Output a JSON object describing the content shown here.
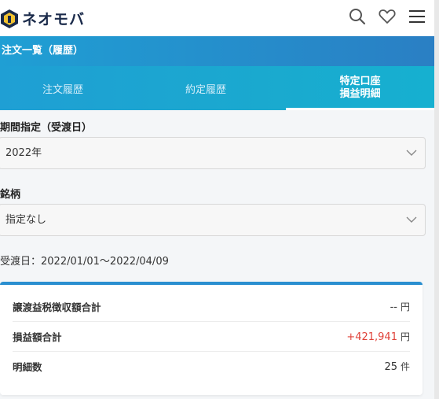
{
  "header": {
    "logo_text": "ネオモバ",
    "icons": [
      "search-icon",
      "heart-icon",
      "menu-icon"
    ]
  },
  "page_title": "注文一覧（履歴）",
  "tabs": [
    {
      "label": "注文履歴",
      "active": false
    },
    {
      "label": "約定履歴",
      "active": false
    },
    {
      "label_line1": "特定口座",
      "label_line2": "損益明細",
      "active": true
    }
  ],
  "period": {
    "label": "期間指定（受渡日）",
    "value": "2022年"
  },
  "issue": {
    "label": "銘柄",
    "value": "指定なし"
  },
  "date_range": "受渡日：2022/01/01〜2022/04/09",
  "summary": {
    "rows": [
      {
        "label": "譲渡益税徴収額合計",
        "value": "--",
        "unit": "円"
      },
      {
        "label": "損益額合計",
        "value": "+421,941",
        "unit": "円"
      },
      {
        "label": "明細数",
        "value": "25",
        "unit": "件"
      }
    ]
  },
  "colors": {
    "accent": "#1f9fd4",
    "positive": "#e0433a"
  }
}
